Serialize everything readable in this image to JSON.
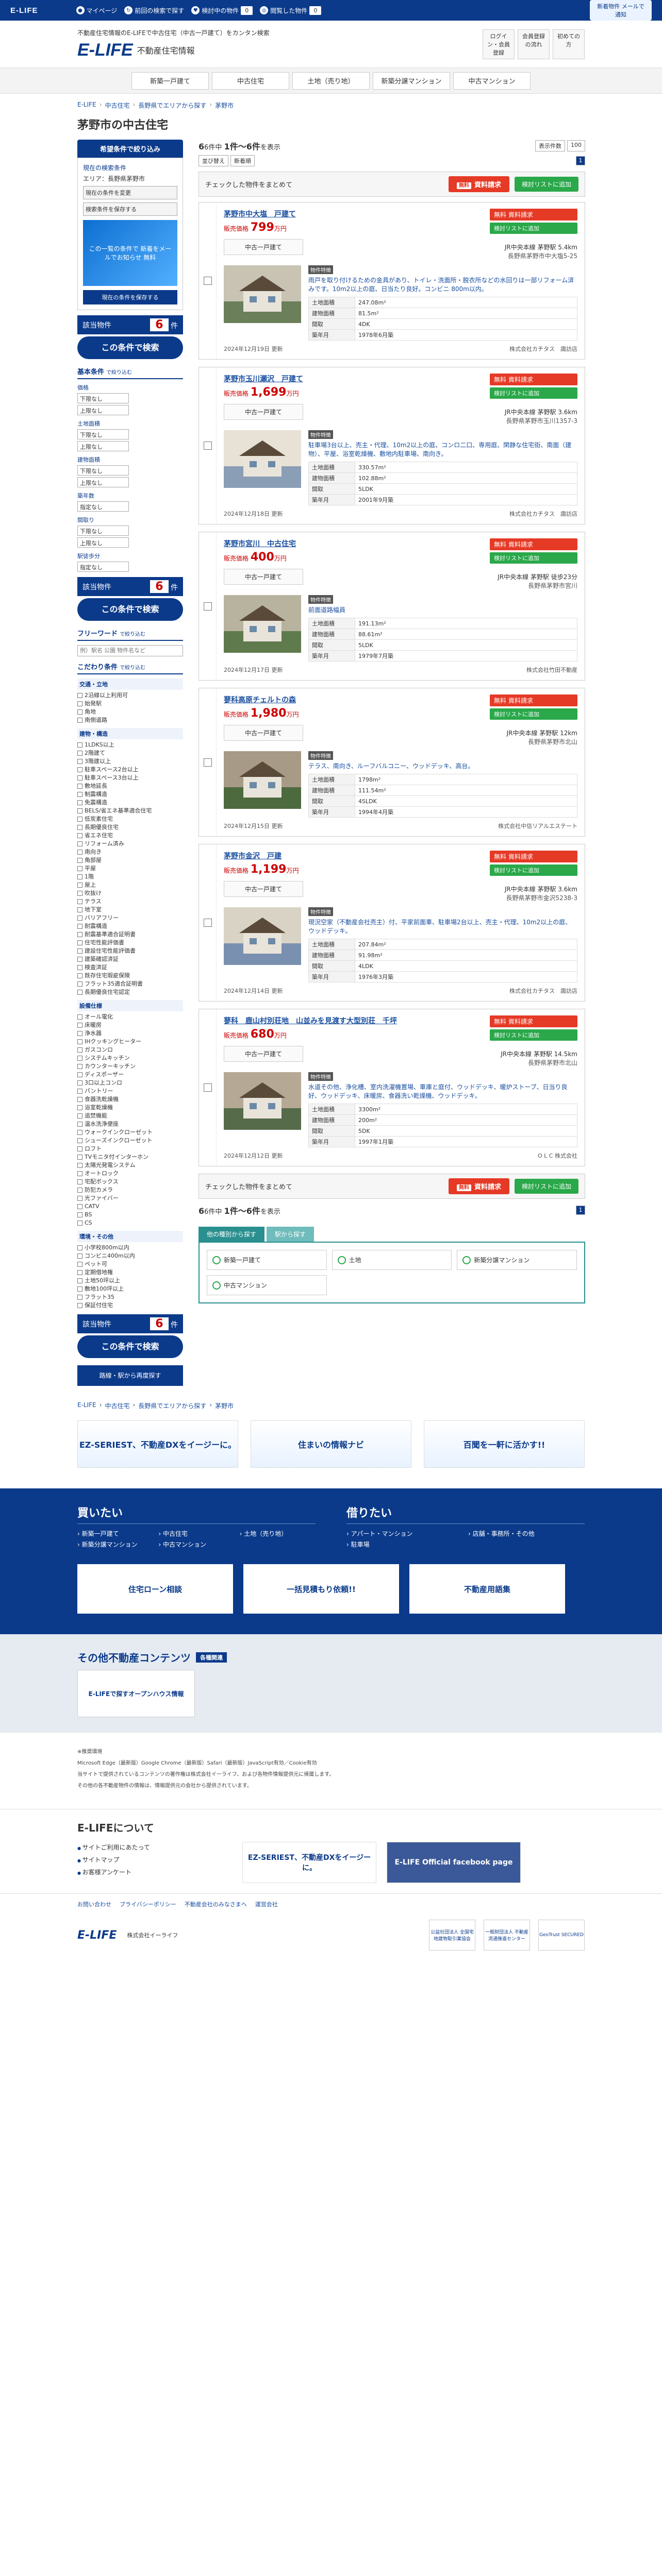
{
  "topbar": {
    "brand": "E-LIFE",
    "links": [
      "マイページ",
      "前回の検索で探す",
      "検討中の物件",
      "閲覧した物件"
    ],
    "counts": [
      "0",
      "0"
    ],
    "promo": "新着物件 メールで通知"
  },
  "header": {
    "tagline": "不動産住宅情報のE-LIFEで中古住宅（中古一戸建て）をカンタン検索",
    "logo": "E-LIFE",
    "logo_sub": "不動産住宅情報",
    "buttons": [
      "ログイン・会員登録",
      "会員登録の流れ",
      "初めての方"
    ]
  },
  "gnav": [
    "新築一戸建て",
    "中古住宅",
    "土地（売り地）",
    "新築分譲マンション",
    "中古マンション"
  ],
  "breadcrumb": [
    "E-LIFE",
    "中古住宅",
    "長野県でエリアから探す",
    "茅野市"
  ],
  "page_title": "茅野市の中古住宅",
  "sidebar": {
    "head": "希望条件で絞り込み",
    "current_label": "現在の検索条件",
    "area_label": "エリア：長野県茅野市",
    "btn_change": "現在の条件を変更",
    "btn_save": "検索条件を保存する",
    "promo": "この一覧の条件で 新着をメールでお知らせ 無料",
    "btn_save2": "現在の条件を保存する",
    "count_label": "該当物件",
    "count": "6",
    "count_unit": "件",
    "search_btn": "この条件で検索",
    "basic_title": "基本条件",
    "basic_sub": "で絞り込む",
    "price_label": "価格",
    "land_label": "土地面積",
    "building_label": "建物面積",
    "age_label": "築年数",
    "layout_label": "間取り",
    "walk_label": "駅徒歩分",
    "sel_lower": "下限なし",
    "sel_upper": "上限なし",
    "sel_none": "指定なし",
    "free_title": "フリーワード",
    "free_sub": "で絞り込む",
    "free_placeholder": "例）駅名 公園 物件名など",
    "pref_title": "こだわり条件",
    "pref_sub": "で絞り込む",
    "groups": [
      {
        "title": "交通・立地",
        "items": [
          "2沿線以上利用可",
          "始発駅",
          "角地",
          "南側道路"
        ]
      },
      {
        "title": "建物・構造",
        "items": [
          "1LDKS以上",
          "2階建て",
          "3階建以上",
          "駐車スペース2台以上",
          "駐車スペース3台以上",
          "敷地延長",
          "制震構造",
          "免震構造",
          "BELS/省エネ基準適合住宅",
          "低炭素住宅",
          "長期優良住宅",
          "省エネ住宅",
          "リフォーム済み",
          "南向き",
          "角部屋",
          "平屋",
          "1階",
          "屋上",
          "吹抜け",
          "テラス",
          "地下室",
          "バリアフリー",
          "耐震構造",
          "耐震基準適合証明書",
          "住宅性能評価書",
          "建設住宅性能評価書",
          "建築確認済証",
          "検査済証",
          "既存住宅瑕疵保険",
          "フラット35適合証明書",
          "長期優良住宅認定"
        ]
      },
      {
        "title": "設備仕様",
        "items": [
          "オール電化",
          "床暖房",
          "浄水器",
          "IHクッキングヒーター",
          "ガスコンロ",
          "システムキッチン",
          "カウンターキッチン",
          "ディスポーザー",
          "3口以上コンロ",
          "パントリー",
          "食器洗乾燥機",
          "浴室乾燥機",
          "追焚機能",
          "温水洗浄便座",
          "ウォークインクローゼット",
          "シューズインクローゼット",
          "ロフト",
          "TVモニタ付インターホン",
          "太陽光発電システム",
          "オートロック",
          "宅配ボックス",
          "防犯カメラ",
          "光ファイバー",
          "CATV",
          "BS",
          "CS"
        ]
      },
      {
        "title": "環境・その他",
        "items": [
          "小学校800m以内",
          "コンビニ400m以内",
          "ペット可",
          "定期借地権",
          "土地50坪以上",
          "敷地100坪以上",
          "フラット35",
          "保証付住宅"
        ]
      }
    ],
    "foot_count": "6",
    "foot_btn": "この条件で検索",
    "foot_link": "路線・駅から再度探す"
  },
  "results": {
    "count_text": "6件中",
    "range": "1件～6件",
    "range_suffix": "を表示",
    "sort_label": "表示件数",
    "sort_value": "100",
    "order_label": "並び替え",
    "order_value": "新着順",
    "page": "1",
    "check_all": "チェックした物件をまとめて",
    "req_pill": "無料",
    "req_btn": "資料請求",
    "fav_btn": "検討リストに追加",
    "type_label": "中古一戸建て",
    "feat_tag": "物件特徴",
    "spec_keys": [
      "土地面積",
      "建物面積",
      "間取",
      "築年月"
    ],
    "card_req": "無料 資料請求",
    "card_fav": "検討リストに追加",
    "listings": [
      {
        "title": "茅野市中大塩　戸建て",
        "price_label": "販売価格",
        "price": "799",
        "unit": "万円",
        "station": "JR中央本線 茅野駅 5.4km",
        "address": "長野県茅野市中大塩5-25",
        "feature": "雨戸を取り付けるための金具があり、トイレ・洗面所・脱衣所などの水回りは一部リフォーム済みです。10m2以上の庭、日当たり良好。コンビニ 800m以内。",
        "land": "247.08m²",
        "building": "81.5m²",
        "layout": "4DK",
        "built": "1978年6月築",
        "updated": "2024年12月19日 更新",
        "agent": "株式会社カチタス　諏訪店"
      },
      {
        "title": "茅野市玉川瀬沢　戸建て",
        "price_label": "販売価格",
        "price": "1,699",
        "unit": "万円",
        "station": "JR中央本線 茅野駅 3.6km",
        "address": "長野県茅野市玉川1357-3",
        "feature": "駐車場3台以上、売主・代理、10m2以上の庭、コンロ二口、専用庭、閑静な住宅街、南面（建物）、平屋、浴室乾燥機、敷地内駐車場、南向き。",
        "land": "330.57m²",
        "building": "102.88m²",
        "layout": "5LDK",
        "built": "2001年9月築",
        "updated": "2024年12月18日 更新",
        "agent": "株式会社カチタス　諏訪店"
      },
      {
        "title": "茅野市宮川　中古住宅",
        "price_label": "販売価格",
        "price": "400",
        "unit": "万円",
        "station": "JR中央本線 茅野駅 徒歩23分",
        "address": "長野県茅野市宮川",
        "feature": "前面道路幅員",
        "land": "191.13m²",
        "building": "88.61m²",
        "layout": "5LDK",
        "built": "1979年7月築",
        "updated": "2024年12月17日 更新",
        "agent": "株式会社竹田不動産"
      },
      {
        "title": "蓼科高原チェルトの森",
        "price_label": "販売価格",
        "price": "1,980",
        "unit": "万円",
        "station": "JR中央本線 茅野駅 12km",
        "address": "長野県茅野市北山",
        "feature": "テラス、南向き、ルーフバルコニー、ウッドデッキ、高台。",
        "land": "1798m²",
        "building": "111.54m²",
        "layout": "4SLDK",
        "built": "1994年4月築",
        "updated": "2024年12月15日 更新",
        "agent": "株式会社中信リアルエステート"
      },
      {
        "title": "茅野市金沢　戸建",
        "price_label": "販売価格",
        "price": "1,199",
        "unit": "万円",
        "station": "JR中央本線 茅野駅 3.6km",
        "address": "長野県茅野市金沢5238-3",
        "feature": "現況空家（不動産会社売主）付、平家前面車、駐車場2台以上、売主・代理、10m2以上の庭、ウッドデッキ。",
        "land": "207.84m²",
        "building": "91.98m²",
        "layout": "4LDK",
        "built": "1976年3月築",
        "updated": "2024年12月14日 更新",
        "agent": "株式会社カチタス　諏訪店"
      },
      {
        "title": "蓼科　鹿山村別荘地　山並みを見渡す大型別荘　千坪",
        "price_label": "販売価格",
        "price": "680",
        "unit": "万円",
        "station": "JR中央本線 茅野駅 14.5km",
        "address": "長野県茅野市北山",
        "feature": "水道その他、浄化槽、室内洗濯機置場、車庫と庭付、ウッドデッキ、暖炉ストーブ、日当り良好、ウッドデッキ、床暖房、食器洗い乾燥機、ウッドデッキ。",
        "land": "3300m²",
        "building": "200m²",
        "layout": "5DK",
        "built": "1997年1月築",
        "updated": "2024年12月12日 更新",
        "agent": "O L C 株式会社"
      }
    ]
  },
  "tabs": [
    "他の種別から探す",
    "駅から探す"
  ],
  "tab_links": [
    "新築一戸建て",
    "土地",
    "新築分譲マンション",
    "中古マンション"
  ],
  "banners": [
    "EZ-SERIEST、不動産DXをイージーに。",
    "住まいの情報ナビ",
    "百聞を一軒に活かす!!"
  ],
  "footer": {
    "buy_title": "買いたい",
    "buy_items": [
      "新築一戸建て",
      "中古住宅",
      "土地（売り地）",
      "新築分譲マンション",
      "中古マンション"
    ],
    "rent_title": "借りたい",
    "rent_items": [
      "アパート・マンション",
      "店舗・事務所・その他",
      "駐車場"
    ],
    "promos": [
      "住宅ローン相談",
      "一括見積もり依頼!!",
      "不動産用語集"
    ],
    "others_title": "その他不動産コンテンツ",
    "others_tag": "各種関連",
    "others_banner": "E-LIFEで探すオープンハウス情報",
    "notes": [
      "※推奨環境",
      "Microsoft Edge（最新版）Google Chrome（最新版）Safari（最新版）JavaScript有効／Cookie有効",
      "当サイトで提供されているコンテンツの著作権は株式会社イーライフ、および各物件情報提供元に帰属します。",
      "その他の各不動産物件の情報は、情報提供元の会社から提供されています。"
    ],
    "about_title": "E-LIFEについて",
    "about_links": [
      "サイトご利用にあたって",
      "サイトマップ",
      "お客様アンケート"
    ],
    "about_banners": [
      "EZ-SERIEST、不動産DXをイージーに。",
      "E-LIFE Official facebook page"
    ],
    "legal": [
      "お問い合わせ",
      "プライバシーポリシー",
      "不動産会社のみなさまへ",
      "運営会社"
    ],
    "logo": "E-LIFE",
    "company": "株式会社イーライフ",
    "certs": [
      "公益社団法人 全国宅地建物取引業協会",
      "一般財団法人 不動産流通推進センター",
      "GeoTrust SECURED"
    ]
  }
}
